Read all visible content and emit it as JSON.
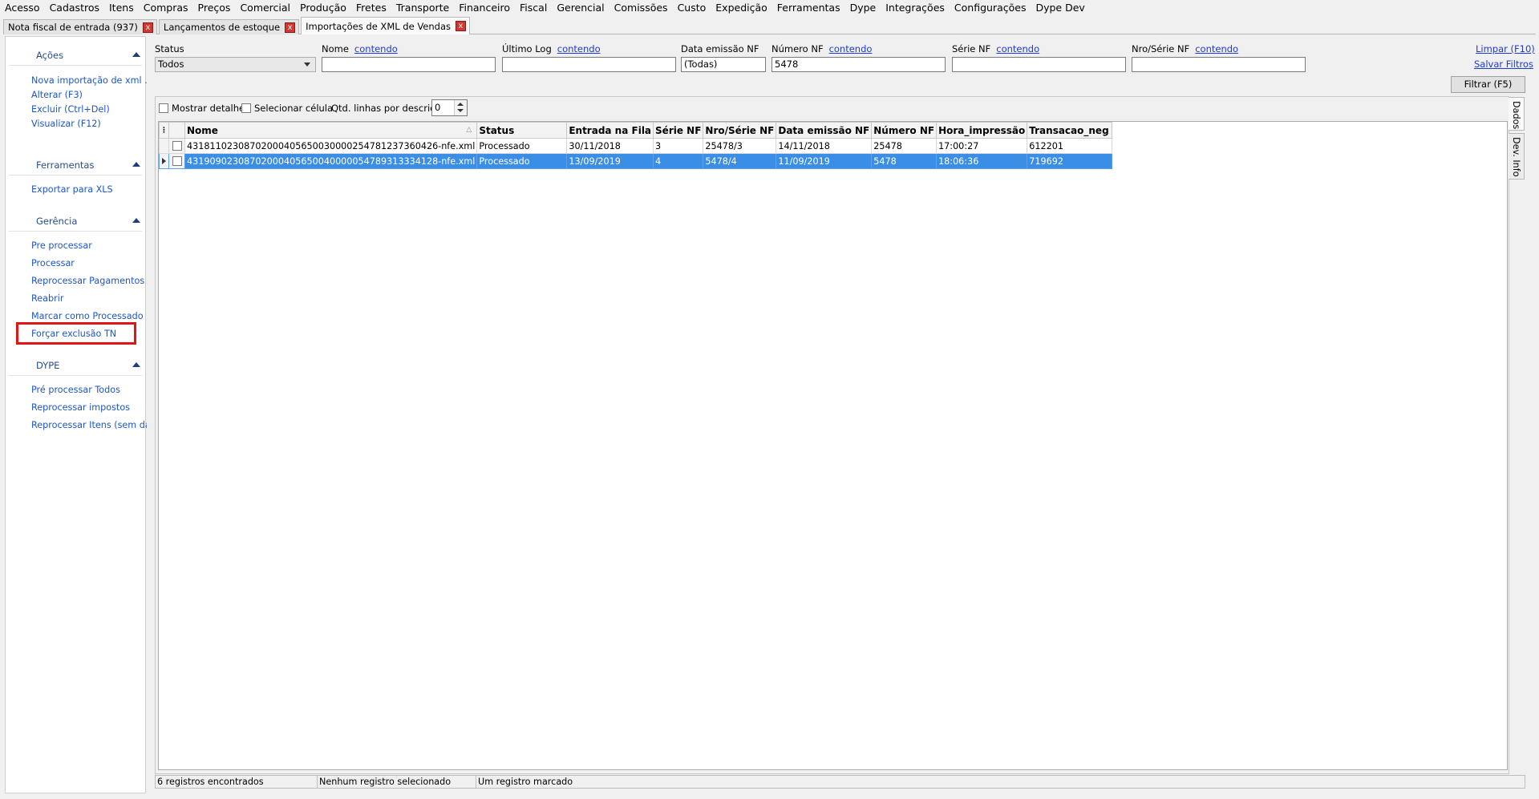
{
  "menu": [
    "Acesso",
    "Cadastros",
    "Itens",
    "Compras",
    "Preços",
    "Comercial",
    "Produção",
    "Fretes",
    "Transporte",
    "Financeiro",
    "Fiscal",
    "Gerencial",
    "Comissões",
    "Custo",
    "Expedição",
    "Ferramentas",
    "Dype",
    "Integrações",
    "Configurações",
    "Dype Dev"
  ],
  "tabs": [
    {
      "label": "Nota fiscal de entrada (937)",
      "close": "x"
    },
    {
      "label": "Lançamentos de estoque",
      "close": "x"
    },
    {
      "label": "Importações de XML de Vendas",
      "close": "x"
    }
  ],
  "sidebar": {
    "groups": [
      {
        "title": "Ações",
        "items": [
          "Nova importação de xml ...",
          "Alterar (F3)",
          "Excluir (Ctrl+Del)",
          "Visualizar (F12)"
        ]
      },
      {
        "title": "Ferramentas",
        "items": [
          "Exportar para XLS"
        ]
      },
      {
        "title": "Gerência",
        "items": [
          "Pre processar",
          "Processar",
          "Reprocessar Pagamentos",
          "Reabrir",
          "Marcar como Processado",
          "Forçar exclusão TN"
        ]
      },
      {
        "title": "DYPE",
        "items": [
          "Pré processar Todos",
          "Reprocessar impostos",
          "Reprocessar Itens (sem da..."
        ]
      }
    ]
  },
  "filters": {
    "status": {
      "label": "Status",
      "value": "Todos"
    },
    "nome": {
      "label": "Nome",
      "mode": "contendo",
      "value": ""
    },
    "ultimo_log": {
      "label": "Último Log",
      "mode": "contendo",
      "value": ""
    },
    "data_emissao": {
      "label": "Data emissão NF",
      "value": "(Todas)"
    },
    "numero_nf": {
      "label": "Número NF",
      "mode": "contendo",
      "value": "5478"
    },
    "serie_nf": {
      "label": "Série NF",
      "mode": "contendo",
      "value": ""
    },
    "nro_serie_nf": {
      "label": "Nro/Série NF",
      "mode": "contendo",
      "value": ""
    },
    "limpar": "Limpar (F10)",
    "salvar": "Salvar Filtros",
    "filtrar": "Filtrar (F5)"
  },
  "options": {
    "mostrar_detalhe": "Mostrar detalhe",
    "selecionar_celula": "Selecionar célula",
    "qtd_label": "Qtd. linhas por descrição",
    "qtd_value": "0"
  },
  "grid": {
    "columns": [
      "Nome",
      "Status",
      "Entrada na Fila",
      "Série NF",
      "Nro/Série NF",
      "Data emissão NF",
      "Número NF",
      "Hora_impressão",
      "Transacao_neg"
    ],
    "rows": [
      {
        "selected": false,
        "cells": [
          "43181102308702000405650030000254781237360426-nfe.xml",
          "Processado",
          "30/11/2018",
          "3",
          "25478/3",
          "14/11/2018",
          "25478",
          "17:00:27",
          "612201"
        ]
      },
      {
        "selected": true,
        "cells": [
          "43190902308702000405650040000054789313334128-nfe.xml",
          "Processado",
          "13/09/2019",
          "4",
          "5478/4",
          "11/09/2019",
          "5478",
          "18:06:36",
          "719692"
        ]
      }
    ]
  },
  "status_bar": [
    "6 registros encontrados",
    "Nenhum registro selecionado",
    "Um registro marcado"
  ],
  "right_tabs": [
    "Dados",
    "Dev. Info"
  ]
}
